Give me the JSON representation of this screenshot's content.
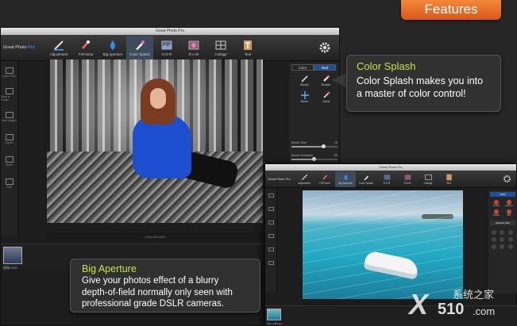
{
  "features_badge": "Features",
  "main_window": {
    "title": "Great Photo Pro",
    "brand_prefix": "Great Photo ",
    "brand_suffix": "Pro",
    "tools": [
      {
        "label": "Adjustment",
        "icon": "adjustment-icon"
      },
      {
        "label": "FXFrame",
        "icon": "fxframe-icon"
      },
      {
        "label": "Big Aperture",
        "icon": "big-aperture-icon"
      },
      {
        "label": "Color Splash",
        "icon": "color-splash-icon"
      },
      {
        "label": "H D R",
        "icon": "hdr-icon"
      },
      {
        "label": "R A W",
        "icon": "raw-icon"
      },
      {
        "label": "Collage",
        "icon": "collage-icon"
      },
      {
        "label": "Text",
        "icon": "text-icon"
      }
    ],
    "rail": [
      "Open Files",
      "Save a Folder",
      "Add Images",
      "Export",
      "Share",
      "Edit"
    ],
    "canvas_bar_label": "Original/Edited",
    "thumbnail_caption": "图像.DNG",
    "panel": {
      "color_tab": "Color",
      "red_tab": "Red",
      "tools": [
        "Brush",
        "Eraser",
        "Move",
        "Clear"
      ],
      "sliders": [
        {
          "label": "Brush Size",
          "value": 70
        },
        {
          "label": "Brush Softness",
          "value": 50
        },
        {
          "label": "Brush Opacity",
          "value": 100
        }
      ]
    }
  },
  "callout_color_splash": {
    "heading": "Color Splash",
    "body": "Color Splash makes you into a master of color control!"
  },
  "callout_big_aperture": {
    "heading": "Big Aperture",
    "line1": "Give your photos effect of a blurry",
    "line2": "depth-of-field normally only seen with",
    "line3": "professional grade DSLR cameras."
  },
  "second_window": {
    "title": "Great Photo Pro",
    "brand": "Great Photo Pro",
    "tools": [
      "Adjustment",
      "FXFrame",
      "Big Aperture",
      "Color Splash",
      "H D R",
      "R A W",
      "Collage",
      "Text"
    ],
    "mode_label": "Mode",
    "aperture_label": "Aperture Size",
    "effects": [
      "Portrait",
      "Aperture",
      "Subject",
      "Blur"
    ],
    "thumbnail_caption": "IMG_4488.jpg"
  },
  "watermark": {
    "x": "X",
    "cn": "系统之家",
    "num": "510",
    "com": ".com"
  },
  "colors": {
    "accent_orange": "#e86a27",
    "callout_heading": "#c6e54a",
    "sweater_blue": "#1d4ed0",
    "active_tool": "#3d4b5c"
  }
}
